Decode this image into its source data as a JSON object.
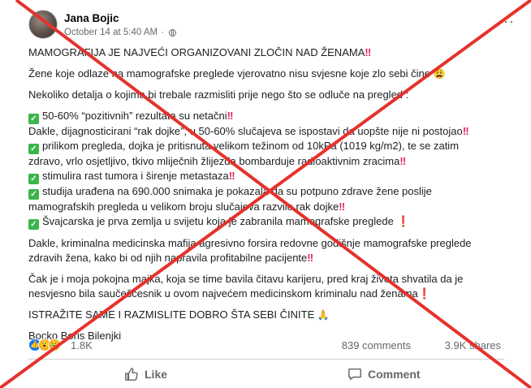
{
  "post": {
    "author": "Jana Bojic",
    "timestamp": "October 14 at 5:40 AM",
    "separator": "·",
    "more_icon": "···",
    "lines": {
      "l1": "MAMOGRAFIJA JE NAJVEĆI ORGANIZOVANI ZLOČIN NAD ŽENAMA",
      "l2": "Žene koje odlaze na mamografske preglede vjerovatno nisu svjesne koje zlo sebi čine",
      "l3": "Nekoliko detalja o kojima bi trebale razmisliti prije nego što se odluče na pregled :",
      "l4": "50-60% “pozitivnih” rezultata su netačni",
      "l5": "Dakle, dijagnosticirani “rak dojke”, u 50-60% slučajeva se ispostavi da uopšte nije ni postojao",
      "l6": "prilikom pregleda, dojka je pritisnuta velikom težinom od 10kPa (1019 kg/m2), te se zatim",
      "l7": "zdravo, vrlo osjetljivo, tkivo mliječnih žlijezda bombarduje radioaktivnim zracima",
      "l8": "stimulira rast tumora i širenje metastaza",
      "l9": "studija urađena na 690.000 snimaka je pokazala da su potpuno zdrave žene poslije",
      "l10": "mamografskih pregleda u velikom broju slučajeva razvile rak dojke",
      "l11": "Švajcarska je prva zemlja u svijetu koja je zabranila mamografske preglede",
      "l12": "Dakle, kriminalna medicinska mafija agresivno forsira redovne godišnje  mamografske preglede",
      "l13": "zdravih žena, kako bi od njih napravila profitabilne pacijente",
      "l14": "Čak je i moja pokojna majka, koja se time bavila čitavu karijeru, pred kraj života shvatila da je",
      "l15": "nesvjesno bila saučešćesnik u ovom najvećem medicinskom kriminalu nad ženama",
      "l16": "ISTRAŽITE SAME I RAZMISLITE DOBRO ŠTA SEBI ČINITE",
      "l17": "Bocko Boris Bilenjki"
    },
    "marks": {
      "double_bang": "‼",
      "single_bang": "❗",
      "check": "✓",
      "grin": "😩",
      "pray": "🙏"
    }
  },
  "stats": {
    "reactions": "1.8K",
    "comments": "839 comments",
    "shares": "3.9K shares",
    "reaction_icons": [
      "like-icon",
      "wow-icon",
      "sad-icon"
    ]
  },
  "actions": {
    "like": "Like",
    "comment": "Comment"
  },
  "colors": {
    "cross": "#e5322b",
    "check_bg": "#3bb54a",
    "bang": "#e0245e",
    "like_blue": "#1877f2"
  }
}
